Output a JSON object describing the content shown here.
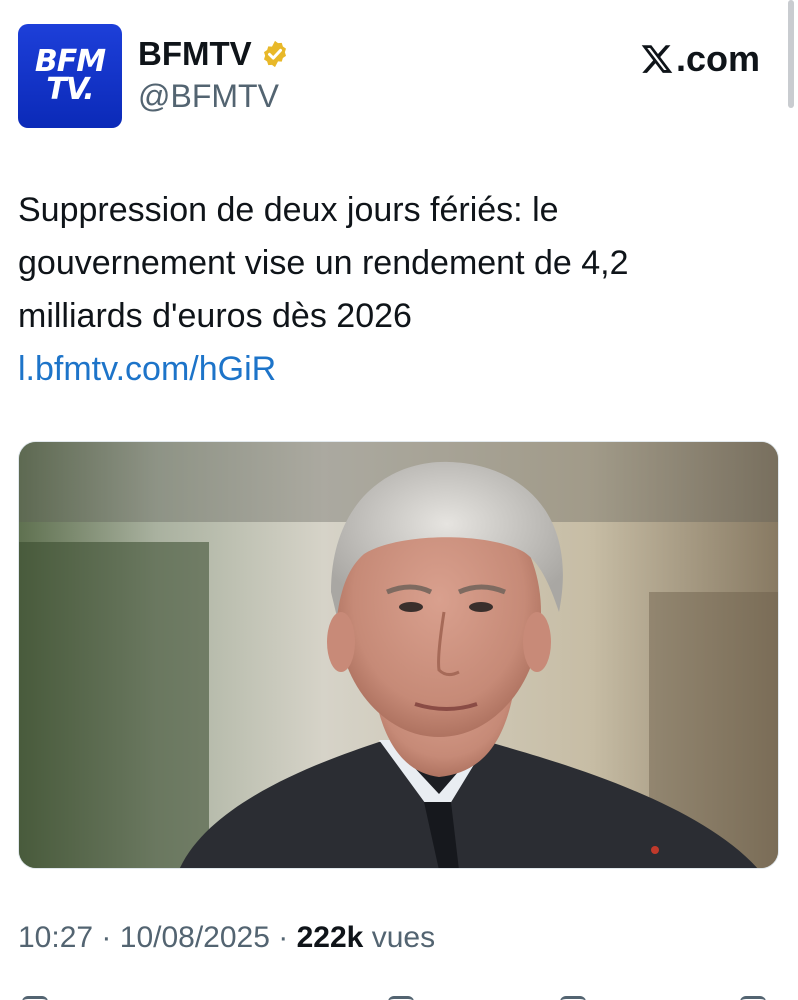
{
  "account": {
    "avatar_line1": "BFM",
    "avatar_line2": "TV.",
    "display_name": "BFMTV",
    "handle": "@BFMTV",
    "verified_color": "#e8b829"
  },
  "brand": {
    "site_label": ".com"
  },
  "tweet": {
    "text": "Suppression de deux jours fériés: le gouvernement vise un rendement de 4,2 milliards d'euros dès 2026",
    "link": "l.bfmtv.com/hGiR",
    "link_color": "#1d74c9"
  },
  "meta": {
    "time": "10:27",
    "separator": "·",
    "date": "10/08/2025",
    "views_count": "222k",
    "views_label": "vues"
  },
  "icons": {
    "verified": "verified-badge-icon",
    "x_logo": "x-logo-icon"
  }
}
